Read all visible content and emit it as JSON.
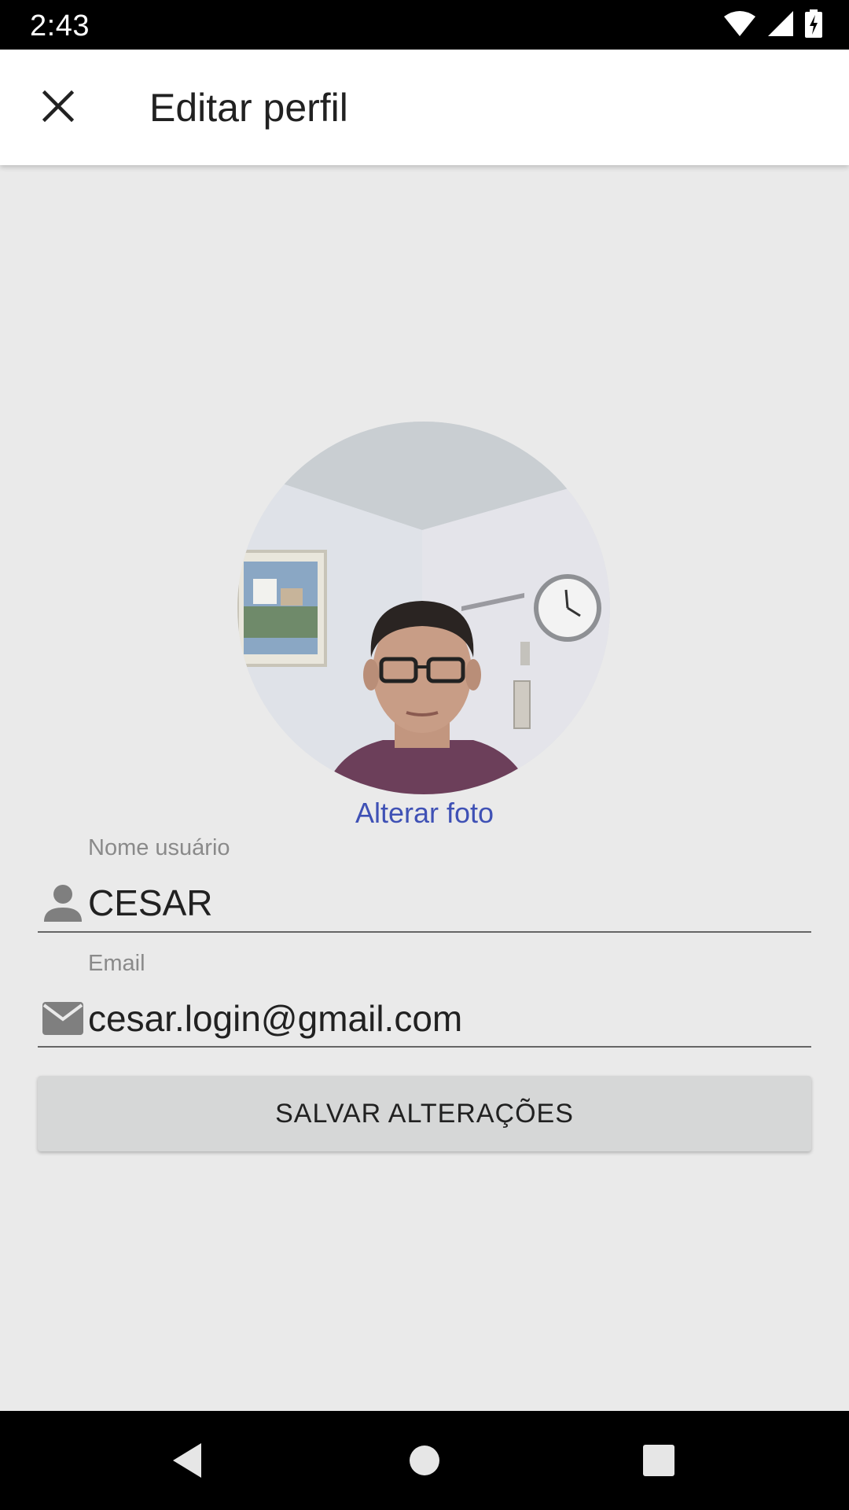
{
  "status_bar": {
    "time": "2:43",
    "icons": [
      "wifi-icon",
      "signal-icon",
      "battery-charging-icon"
    ]
  },
  "app_bar": {
    "close_icon": "close-icon",
    "title": "Editar perfil"
  },
  "profile": {
    "photo_alt": "Foto de perfil",
    "change_photo_label": "Alterar foto"
  },
  "form": {
    "username": {
      "label": "Nome usuário",
      "value": "CESAR",
      "icon": "person-icon"
    },
    "email": {
      "label": "Email",
      "value": "cesar.login@gmail.com",
      "icon": "email-icon"
    },
    "save_label": "SALVAR ALTERAÇÕES"
  },
  "nav_bar": {
    "buttons": [
      "back-icon",
      "home-icon",
      "recents-icon"
    ]
  },
  "colors": {
    "accent": "#3f51b5",
    "background": "#eaeaea",
    "app_bar": "#ffffff",
    "button": "#d6d7d7"
  }
}
